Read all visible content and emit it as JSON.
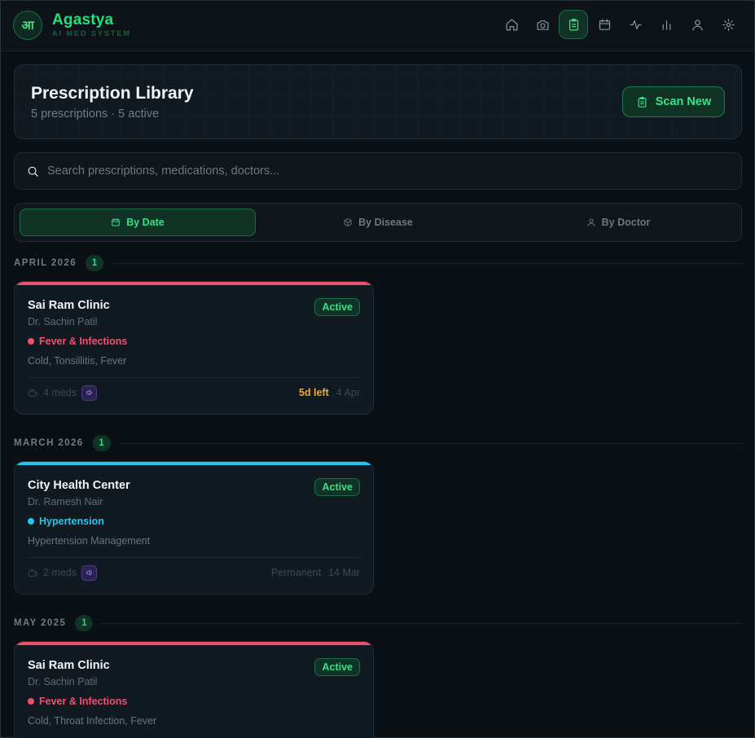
{
  "header": {
    "logo_text": "आ",
    "brand_name": "Agastya",
    "brand_sub": "AI MED SYSTEM",
    "nav": [
      {
        "icon": "home-icon"
      },
      {
        "icon": "camera-icon"
      },
      {
        "icon": "clipboard-icon",
        "active": true
      },
      {
        "icon": "calendar-icon"
      },
      {
        "icon": "activity-icon"
      },
      {
        "icon": "bar-chart-icon"
      },
      {
        "icon": "user-icon"
      },
      {
        "icon": "gear-icon"
      }
    ]
  },
  "title_card": {
    "title": "Prescription Library",
    "subtitle": "5 prescriptions · 5 active",
    "scan_label": "Scan New"
  },
  "search": {
    "placeholder": "Search prescriptions, medications, doctors..."
  },
  "tabs": [
    {
      "label": "By Date",
      "active": true
    },
    {
      "label": "By Disease"
    },
    {
      "label": "By Doctor"
    }
  ],
  "colors": {
    "accent": "#22e07a",
    "fever": "#f0506e",
    "hypertension": "#1ec8f0",
    "warning": "#f0a92d"
  },
  "groups": [
    {
      "label": "APRIL 2026",
      "count": "1",
      "card": {
        "clinic": "Sai Ram Clinic",
        "doctor": "Dr. Sachin Patil",
        "disease": "Fever & Infections",
        "disease_color": "#f0506e",
        "conditions": "Cold, Tonsillitis, Fever",
        "status": "Active",
        "meds": "4 meds",
        "remaining": "5d left",
        "date": "4 Apr"
      }
    },
    {
      "label": "MARCH 2026",
      "count": "1",
      "card": {
        "clinic": "City Health Center",
        "doctor": "Dr. Ramesh Nair",
        "disease": "Hypertension",
        "disease_color": "#1ec8f0",
        "conditions": "Hypertension Management",
        "status": "Active",
        "meds": "2 meds",
        "remaining": "Permanent",
        "date": "14 Mar"
      }
    },
    {
      "label": "MAY 2025",
      "count": "1",
      "card": {
        "clinic": "Sai Ram Clinic",
        "doctor": "Dr. Sachin Patil",
        "disease": "Fever & Infections",
        "disease_color": "#f0506e",
        "conditions": "Cold, Throat Infection, Fever",
        "status": "Active"
      }
    }
  ]
}
